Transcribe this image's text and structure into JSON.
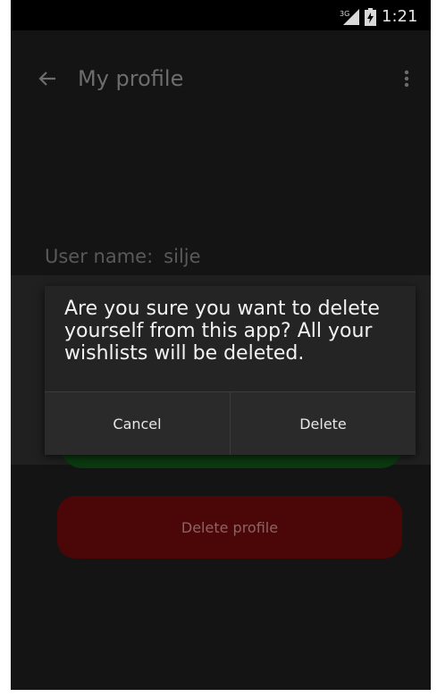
{
  "status_bar": {
    "network_label": "3G",
    "time": "1:21"
  },
  "app_bar": {
    "title": "My profile"
  },
  "profile": {
    "username_label": "User name:",
    "username_value": "silje"
  },
  "dialog": {
    "message": "Are you sure you want to delete yourself from this app? All your wishlists will be deleted.",
    "cancel_label": "Cancel",
    "delete_label": "Delete"
  },
  "buttons": {
    "delete_profile_label": "Delete profile"
  },
  "colors": {
    "background": "#000000",
    "dialog_bg": "#242424",
    "delete_profile_bg": "#4b0707",
    "green_button_bg": "#0b3a10"
  }
}
